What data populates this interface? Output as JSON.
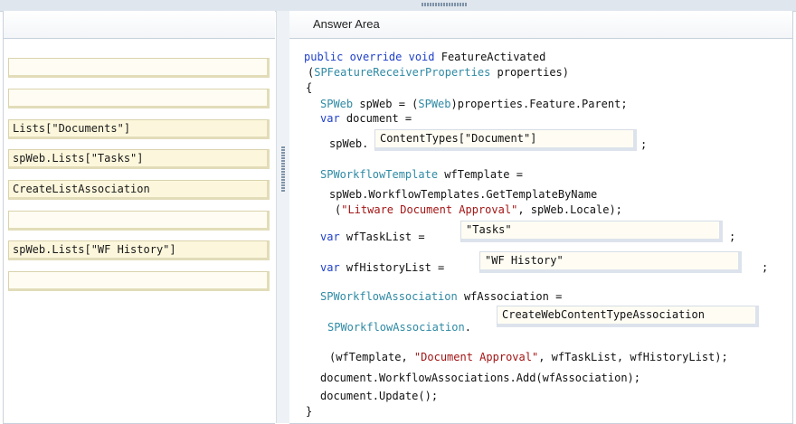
{
  "answer_area": {
    "title": "Answer Area"
  },
  "left_items": [
    "",
    "",
    "Lists[\"Documents\"]",
    "spWeb.Lists[\"Tasks\"]",
    "CreateListAssociation",
    "",
    "spWeb.Lists[\"WF History\"]",
    ""
  ],
  "code": {
    "l1_kw": "public override void",
    "l1_rest": " FeatureActivated",
    "l2_open": "(",
    "l2_type": "SPFeatureReceiverProperties",
    "l2_rest": " properties)",
    "l3": "{",
    "l4_type1": "SPWeb",
    "l4_mid": " spWeb = (",
    "l4_type2": "SPWeb",
    "l4_rest": ")properties.Feature.Parent;",
    "l5_kw": "var",
    "l5_rest": " document =",
    "l6_prefix": "spWeb.",
    "l6_suffix": ";",
    "l7_type": "SPWorkflowTemplate",
    "l7_rest": " wfTemplate =",
    "l8": "spWeb.WorkflowTemplates.GetTemplateByName",
    "l9_open": "(",
    "l9_str": "\"Litware Document Approval\"",
    "l9_rest": ", spWeb.Locale);",
    "l10_kw": "var",
    "l10_rest": " wfTaskList =",
    "l10_suffix": ";",
    "l11_kw": "var",
    "l11_rest": " wfHistoryList =",
    "l11_suffix": ";",
    "l12_type": "SPWorkflowAssociation",
    "l12_rest": " wfAssociation =",
    "l13_type": "SPWorkflowAssociation",
    "l13_dot": ".",
    "l14_open": "(wfTemplate, ",
    "l14_str": "\"Document Approval\"",
    "l14_rest": ", wfTaskList, wfHistoryList);",
    "l15": "document.WorkflowAssociations.Add(wfAssociation);",
    "l16": "document.Update();",
    "l17": "}"
  },
  "answer_slots": {
    "content_types": "ContentTypes[\"Document\"]",
    "task_list": "\"Tasks\"",
    "history_list": "\"WF History\"",
    "association": "CreateWebContentTypeAssociation"
  }
}
